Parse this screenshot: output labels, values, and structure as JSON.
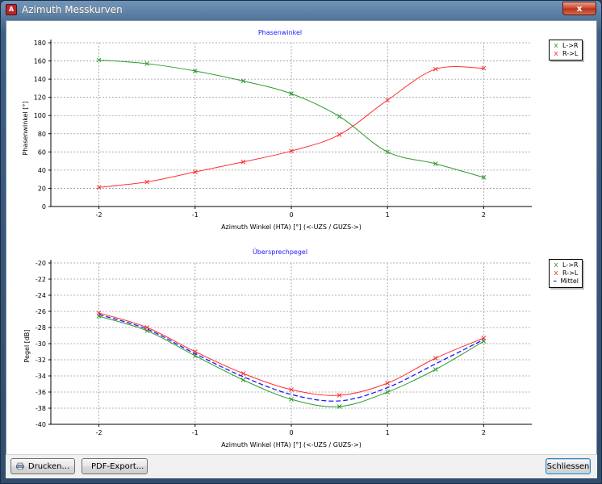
{
  "window": {
    "title": "Azimuth Messkurven",
    "icon": "app-pdf-icon",
    "close_label": "x"
  },
  "colors": {
    "l_to_r": "#2e9a2e",
    "r_to_l": "#ff3030",
    "mittel": "#1a1aff",
    "title": "#1a1aff"
  },
  "buttons": {
    "print": {
      "label": "Drucken...",
      "icon": "printer-icon"
    },
    "pdf": {
      "label": "PDF-Export...",
      "icon": "pdf-icon"
    },
    "close": {
      "label": "Schliessen"
    }
  },
  "chart_data": [
    {
      "type": "line",
      "title": "Phasenwinkel",
      "xlabel": "Azimuth Winkel (HTA) [°] (<-UZS / GUZS->)",
      "ylabel": "Phasenwinkel [°]",
      "xlim": [
        -2.5,
        2.5
      ],
      "ylim": [
        0,
        180
      ],
      "xticks": [
        -2,
        -1,
        0,
        1,
        2
      ],
      "yticks": [
        0,
        20,
        40,
        60,
        80,
        100,
        120,
        140,
        160,
        180
      ],
      "grid": true,
      "legend_position": "right",
      "series": [
        {
          "name": "L->R",
          "color": "#2e9a2e",
          "marker": "x",
          "x": [
            -2,
            -1.5,
            -1,
            -0.5,
            0,
            0.5,
            1,
            1.5,
            2
          ],
          "y": [
            161,
            157,
            149,
            138,
            124,
            99,
            60,
            47,
            32
          ]
        },
        {
          "name": "R->L",
          "color": "#ff3030",
          "marker": "x",
          "x": [
            -2,
            -1.5,
            -1,
            -0.5,
            0,
            0.5,
            1,
            1.5,
            2
          ],
          "y": [
            21,
            27,
            38,
            49,
            61,
            79,
            117,
            151,
            152
          ]
        }
      ]
    },
    {
      "type": "line",
      "title": "Übersprechpegel",
      "xlabel": "Azimuth Winkel (HTA) [°] (<-UZS / GUZS->)",
      "ylabel": "Pegel [dB]",
      "xlim": [
        -2.5,
        2.5
      ],
      "ylim": [
        -40,
        -20
      ],
      "xticks": [
        -2,
        -1,
        0,
        1,
        2
      ],
      "yticks": [
        -40,
        -38,
        -36,
        -34,
        -32,
        -30,
        -28,
        -26,
        -24,
        -22,
        -20
      ],
      "grid": true,
      "legend_position": "right",
      "series": [
        {
          "name": "L->R",
          "color": "#2e9a2e",
          "marker": "x",
          "x": [
            -2,
            -1.5,
            -1,
            -0.5,
            0,
            0.5,
            1,
            1.5,
            2
          ],
          "y": [
            -26.6,
            -28.4,
            -31.5,
            -34.5,
            -36.9,
            -37.8,
            -36.0,
            -33.2,
            -29.7
          ]
        },
        {
          "name": "R->L",
          "color": "#ff3030",
          "marker": "x",
          "x": [
            -2,
            -1.5,
            -1,
            -0.5,
            0,
            0.5,
            1,
            1.5,
            2
          ],
          "y": [
            -26.2,
            -28.0,
            -31.0,
            -33.7,
            -35.7,
            -36.4,
            -34.9,
            -31.8,
            -29.3
          ]
        },
        {
          "name": "Mittel",
          "color": "#1a1aff",
          "marker": "none",
          "dashed": true,
          "x": [
            -2,
            -1.5,
            -1,
            -0.5,
            0,
            0.5,
            1,
            1.5,
            2
          ],
          "y": [
            -26.4,
            -28.2,
            -31.25,
            -34.1,
            -36.3,
            -37.1,
            -35.45,
            -32.5,
            -29.5
          ]
        }
      ]
    }
  ]
}
